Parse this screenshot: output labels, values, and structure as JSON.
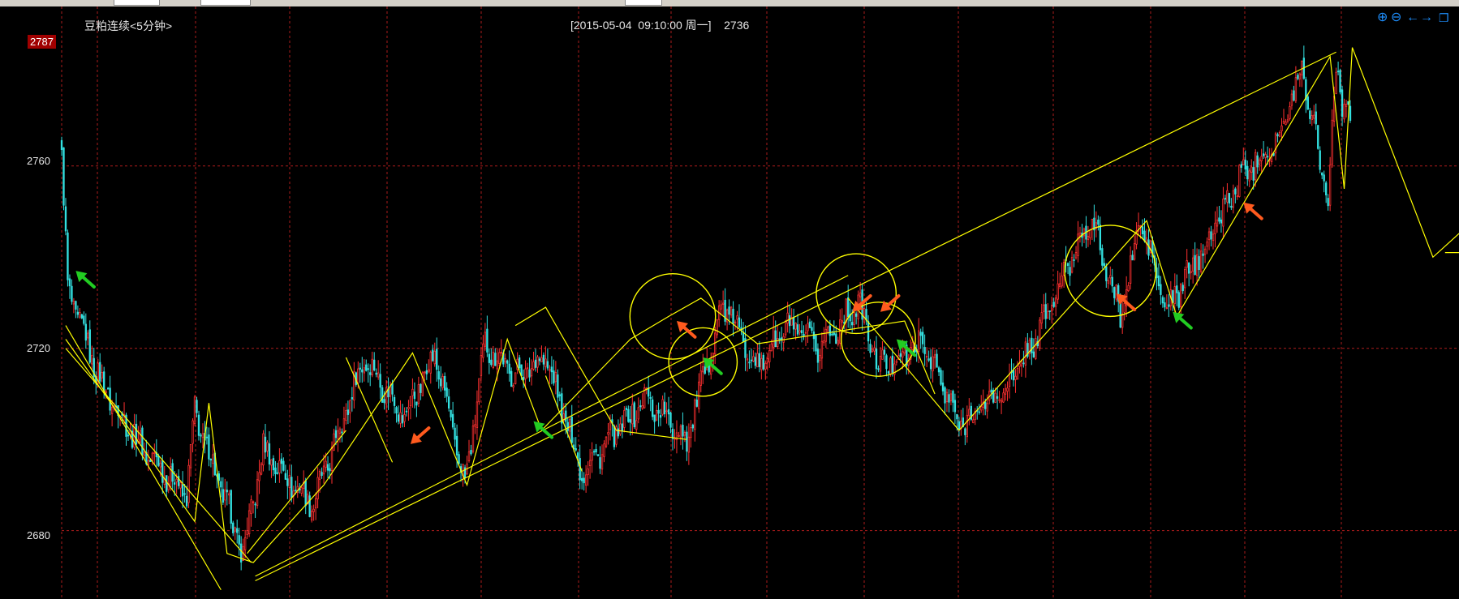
{
  "header": {
    "title": "豆粕连续<5分钟>",
    "cursor_info": "[2015-05-04  09:10:00 周一]    2736"
  },
  "price_tag": "2787",
  "colors": {
    "up": "#ff3030",
    "down": "#33e0e0",
    "annotation": "#ffff00",
    "grid": "#cc2222",
    "buy_arrow": "#22cc22",
    "sell_arrow": "#ff5a1e"
  },
  "toolbar": {
    "icons": [
      "zoom-in-icon",
      "zoom-out-icon",
      "scroll-left-icon",
      "scroll-right-icon",
      "restore-window-icon"
    ]
  },
  "chart_data": {
    "type": "candlestick",
    "title": "豆粕连续<5分钟>",
    "ylim": [
      2665,
      2795
    ],
    "yticks": [
      "2760",
      "2720",
      "2680"
    ],
    "ytick_values": [
      2760,
      2720,
      2680
    ],
    "grid": "dashed red",
    "pivots": [
      {
        "i": 0,
        "p": 2762
      },
      {
        "i": 3,
        "p": 2733
      },
      {
        "i": 20,
        "p": 2712
      },
      {
        "i": 40,
        "p": 2698
      },
      {
        "i": 62,
        "p": 2688
      },
      {
        "i": 66,
        "p": 2706
      },
      {
        "i": 90,
        "p": 2675
      },
      {
        "i": 100,
        "p": 2698
      },
      {
        "i": 115,
        "p": 2690
      },
      {
        "i": 125,
        "p": 2686
      },
      {
        "i": 150,
        "p": 2718
      },
      {
        "i": 170,
        "p": 2705
      },
      {
        "i": 185,
        "p": 2719
      },
      {
        "i": 200,
        "p": 2690
      },
      {
        "i": 210,
        "p": 2721
      },
      {
        "i": 225,
        "p": 2714
      },
      {
        "i": 240,
        "p": 2718
      },
      {
        "i": 258,
        "p": 2693
      },
      {
        "i": 290,
        "p": 2709
      },
      {
        "i": 310,
        "p": 2700
      },
      {
        "i": 318,
        "p": 2713
      },
      {
        "i": 328,
        "p": 2730
      },
      {
        "i": 345,
        "p": 2716
      },
      {
        "i": 360,
        "p": 2725
      },
      {
        "i": 375,
        "p": 2720
      },
      {
        "i": 395,
        "p": 2730
      },
      {
        "i": 405,
        "p": 2716
      },
      {
        "i": 428,
        "p": 2721
      },
      {
        "i": 445,
        "p": 2703
      },
      {
        "i": 470,
        "p": 2712
      },
      {
        "i": 485,
        "p": 2724
      },
      {
        "i": 510,
        "p": 2749
      },
      {
        "i": 525,
        "p": 2727
      },
      {
        "i": 535,
        "p": 2748
      },
      {
        "i": 548,
        "p": 2728
      },
      {
        "i": 570,
        "p": 2745
      },
      {
        "i": 585,
        "p": 2758
      },
      {
        "i": 605,
        "p": 2767
      },
      {
        "i": 615,
        "p": 2782
      },
      {
        "i": 628,
        "p": 2753
      },
      {
        "i": 632,
        "p": 2782
      },
      {
        "i": 637,
        "p": 2770
      }
    ],
    "annotations": {
      "trend_lines": [
        [
          [
            2,
            2725
          ],
          [
            79,
            2667
          ]
        ],
        [
          [
            2,
            2720
          ],
          [
            94,
            2673
          ]
        ],
        [
          [
            96,
            2669
          ],
          [
            632,
            2785
          ]
        ],
        [
          [
            96,
            2670
          ],
          [
            390,
            2736
          ]
        ],
        [
          [
            92,
            2675
          ],
          [
            141,
            2702
          ]
        ],
        [
          [
            141,
            2718
          ],
          [
            164,
            2695
          ]
        ],
        [
          [
            225,
            2725
          ],
          [
            240,
            2729
          ],
          [
            275,
            2702
          ],
          [
            310,
            2700
          ]
        ],
        [
          [
            258,
            2693
          ],
          [
            240,
            2714
          ]
        ],
        [
          [
            390,
            2731
          ],
          [
            445,
            2702
          ]
        ],
        [
          [
            445,
            2702
          ],
          [
            538,
            2748
          ],
          [
            553,
            2727
          ],
          [
            629,
            2784
          ],
          [
            636,
            2755
          ],
          [
            640,
            2786
          ],
          [
            680,
            2740
          ],
          [
            705,
            2750
          ]
        ],
        [
          [
            686,
            2741
          ],
          [
            715,
            2741
          ]
        ]
      ],
      "zigzag": [
        [
          2,
          2722
        ],
        [
          66,
          2682
        ],
        [
          73,
          2708
        ],
        [
          82,
          2675
        ],
        [
          95,
          2673
        ],
        [
          130,
          2690
        ],
        [
          174,
          2719
        ],
        [
          201,
          2690
        ],
        [
          221,
          2722
        ],
        [
          238,
          2702
        ],
        [
          282,
          2722
        ],
        [
          301,
          2727
        ],
        [
          317,
          2731
        ],
        [
          345,
          2721
        ],
        [
          418,
          2726
        ],
        [
          433,
          2710
        ]
      ],
      "circles": [
        [
          303,
          2727,
          15
        ],
        [
          318,
          2717,
          12
        ],
        [
          394,
          2732,
          14
        ],
        [
          405,
          2722,
          13
        ],
        [
          520,
          2737,
          16
        ]
      ],
      "buy_arrows": [
        [
          7,
          2737,
          -1
        ],
        [
          234,
          2704,
          -1
        ],
        [
          318,
          2718,
          -1
        ],
        [
          414,
          2722,
          -1
        ],
        [
          551,
          2728,
          -1
        ]
      ],
      "sell_arrows": [
        [
          173,
          2699,
          1
        ],
        [
          305,
          2726,
          -1
        ],
        [
          392,
          2728,
          1
        ],
        [
          406,
          2728,
          1
        ],
        [
          523,
          2732,
          -1
        ],
        [
          586,
          2752,
          -1
        ]
      ]
    }
  }
}
